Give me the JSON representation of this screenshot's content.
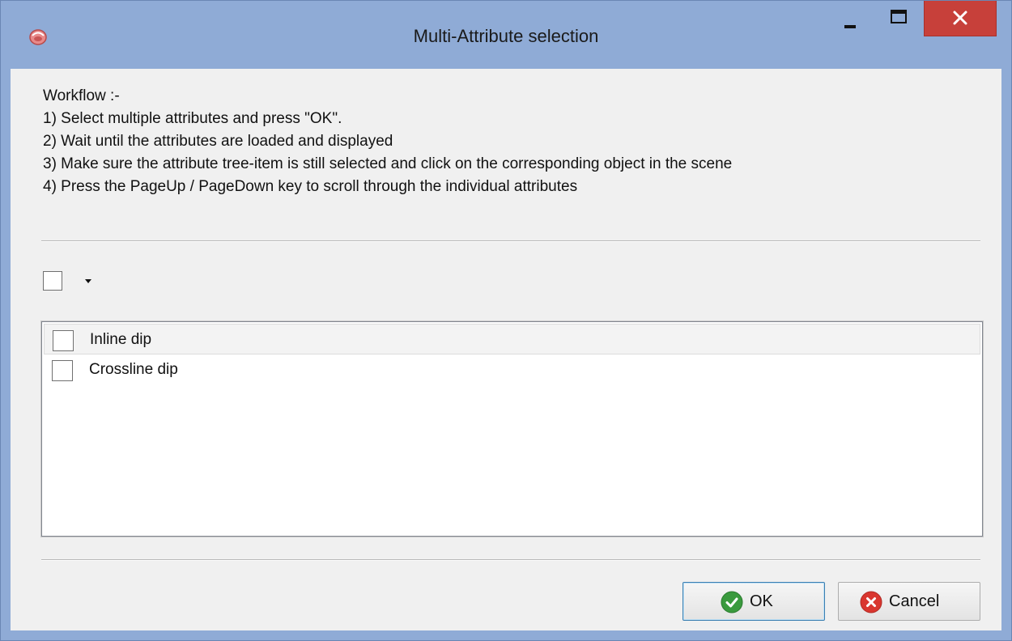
{
  "window": {
    "title": "Multi-Attribute selection"
  },
  "instructions": [
    "Workflow :-",
    "1) Select multiple attributes and press \"OK\".",
    "2) Wait until the attributes are loaded and displayed",
    "3) Make sure the attribute tree-item is still selected and click on the corresponding object in the scene",
    "4) Press the PageUp / PageDown key to scroll through the individual attributes"
  ],
  "attributes": [
    {
      "label": "Inline dip",
      "checked": false
    },
    {
      "label": "Crossline dip",
      "checked": false
    }
  ],
  "buttons": {
    "ok_label": "OK",
    "cancel_label": "Cancel"
  },
  "colors": {
    "close_button": "#c7403a",
    "titlebar": "#8fabd6",
    "ok_icon": "#3a9a3e",
    "cancel_icon": "#d9362f"
  }
}
